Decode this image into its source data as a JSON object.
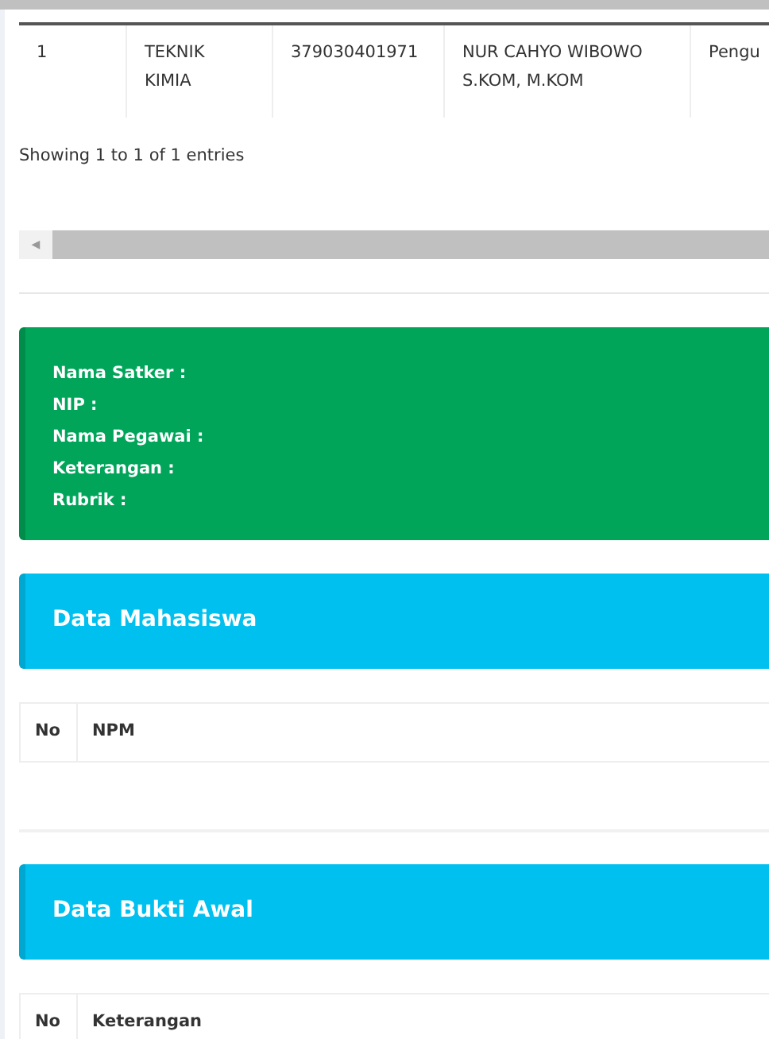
{
  "top_table": {
    "rows": [
      {
        "cells": [
          "1",
          "TEKNIK KIMIA",
          "379030401971",
          "NUR CAHYO WIBOWO S.KOM, M.KOM",
          "Pengu"
        ]
      }
    ]
  },
  "table_info": "Showing 1 to 1 of 1 entries",
  "scroll_arrow": "◀",
  "info_box": {
    "lines": [
      "Nama Satker :",
      "NIP :",
      "Nama Pegawai :",
      "Keterangan :",
      "Rubrik :"
    ]
  },
  "sections": [
    {
      "title": "Data Mahasiswa",
      "columns": [
        "No",
        "NPM"
      ]
    },
    {
      "title": "Data Bukti Awal",
      "columns": [
        "No",
        "Keterangan"
      ]
    }
  ]
}
